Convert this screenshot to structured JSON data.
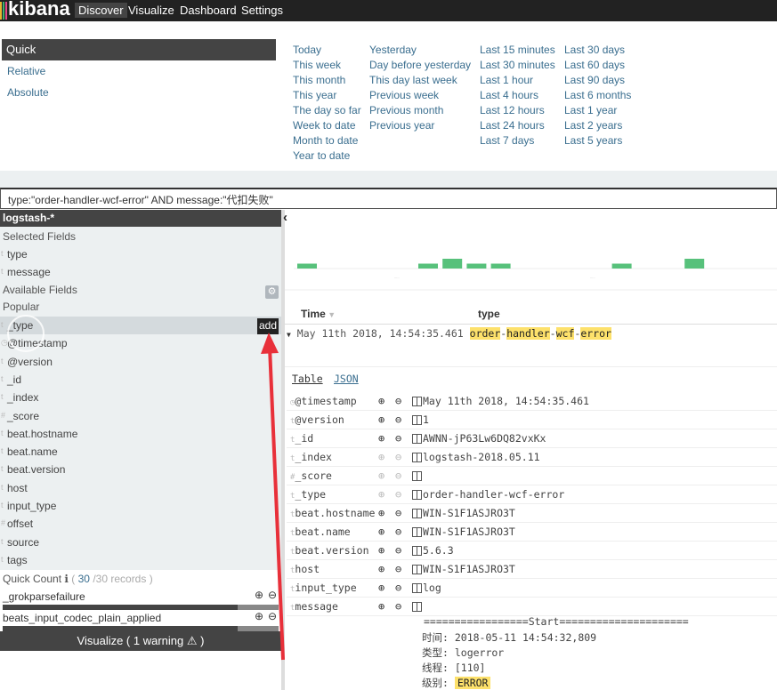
{
  "nav": {
    "logo": "kibana",
    "items": [
      "Discover",
      "Visualize",
      "Dashboard",
      "Settings"
    ],
    "active": "Discover"
  },
  "timepicker": {
    "tabs": [
      "Quick",
      "Relative",
      "Absolute"
    ],
    "columns": [
      [
        "Today",
        "This week",
        "This month",
        "This year",
        "The day so far",
        "Week to date",
        "Month to date",
        "Year to date"
      ],
      [
        "Yesterday",
        "Day before yesterday",
        "This day last week",
        "Previous week",
        "Previous month",
        "Previous year"
      ],
      [
        "Last 15 minutes",
        "Last 30 minutes",
        "Last 1 hour",
        "Last 4 hours",
        "Last 12 hours",
        "Last 24 hours",
        "Last 7 days"
      ],
      [
        "Last 30 days",
        "Last 60 days",
        "Last 90 days",
        "Last 6 months",
        "Last 1 year",
        "Last 2 years",
        "Last 5 years"
      ]
    ]
  },
  "query": "type:\"order-handler-wcf-error\" AND message:\"代扣失败\"",
  "sidebar": {
    "index": "logstash-*",
    "selected_label": "Selected Fields",
    "selected": [
      "type",
      "message"
    ],
    "available_label": "Available Fields",
    "popular_label": "Popular",
    "fields": [
      "_type",
      "@timestamp",
      "@version",
      "_id",
      "_index",
      "_score",
      "beat.hostname",
      "beat.name",
      "beat.version",
      "host",
      "input_type",
      "offset",
      "source",
      "tags"
    ],
    "add_label": "add",
    "quick_count": {
      "label": "Quick Count",
      "count": "30",
      "total": "/30 records",
      "values": [
        "_grokparsefailure",
        "beats_input_codec_plain_applied"
      ],
      "percent": 100
    },
    "visualize": "Visualize ( 1 warning ⚠ )"
  },
  "histogram": {
    "counts": [
      1,
      0,
      0,
      0,
      0,
      1,
      2,
      1,
      1,
      0,
      0,
      0,
      0,
      1,
      0,
      0,
      2
    ],
    "color": "#57c17b"
  },
  "table": {
    "headers": [
      "Time",
      "type"
    ],
    "row_time": "May 11th 2018, 14:54:35.461",
    "row_type_parts": [
      "order",
      "handler",
      "wcf",
      "error"
    ],
    "tabs": [
      "Table",
      "JSON"
    ],
    "fields": [
      {
        "name": "@timestamp",
        "value": "May 11th 2018, 14:54:35.461"
      },
      {
        "name": "@version",
        "value": "1"
      },
      {
        "name": "_id",
        "value": "AWNN-jP63Lw6DQ82vxKx"
      },
      {
        "name": "_index",
        "value": "logstash-2018.05.11"
      },
      {
        "name": "_score",
        "value": ""
      },
      {
        "name": "_type",
        "value": "order-handler-wcf-error"
      },
      {
        "name": "beat.hostname",
        "value": "WIN-S1F1ASJRO3T"
      },
      {
        "name": "beat.name",
        "value": "WIN-S1F1ASJRO3T"
      },
      {
        "name": "beat.version",
        "value": "5.6.3"
      },
      {
        "name": "host",
        "value": "WIN-S1F1ASJRO3T"
      },
      {
        "name": "input_type",
        "value": "log"
      },
      {
        "name": "message",
        "value": ""
      }
    ],
    "message_lines": [
      "=================Start=====================",
      "时间: 2018-05-11 14:54:32,809",
      "类型: logerror",
      "线程: [110]"
    ],
    "message_level_label": "级别: ",
    "message_level": "ERROR"
  },
  "colors": {
    "highlight": "#fde16b",
    "annotation_arrow": "#e8303a"
  }
}
